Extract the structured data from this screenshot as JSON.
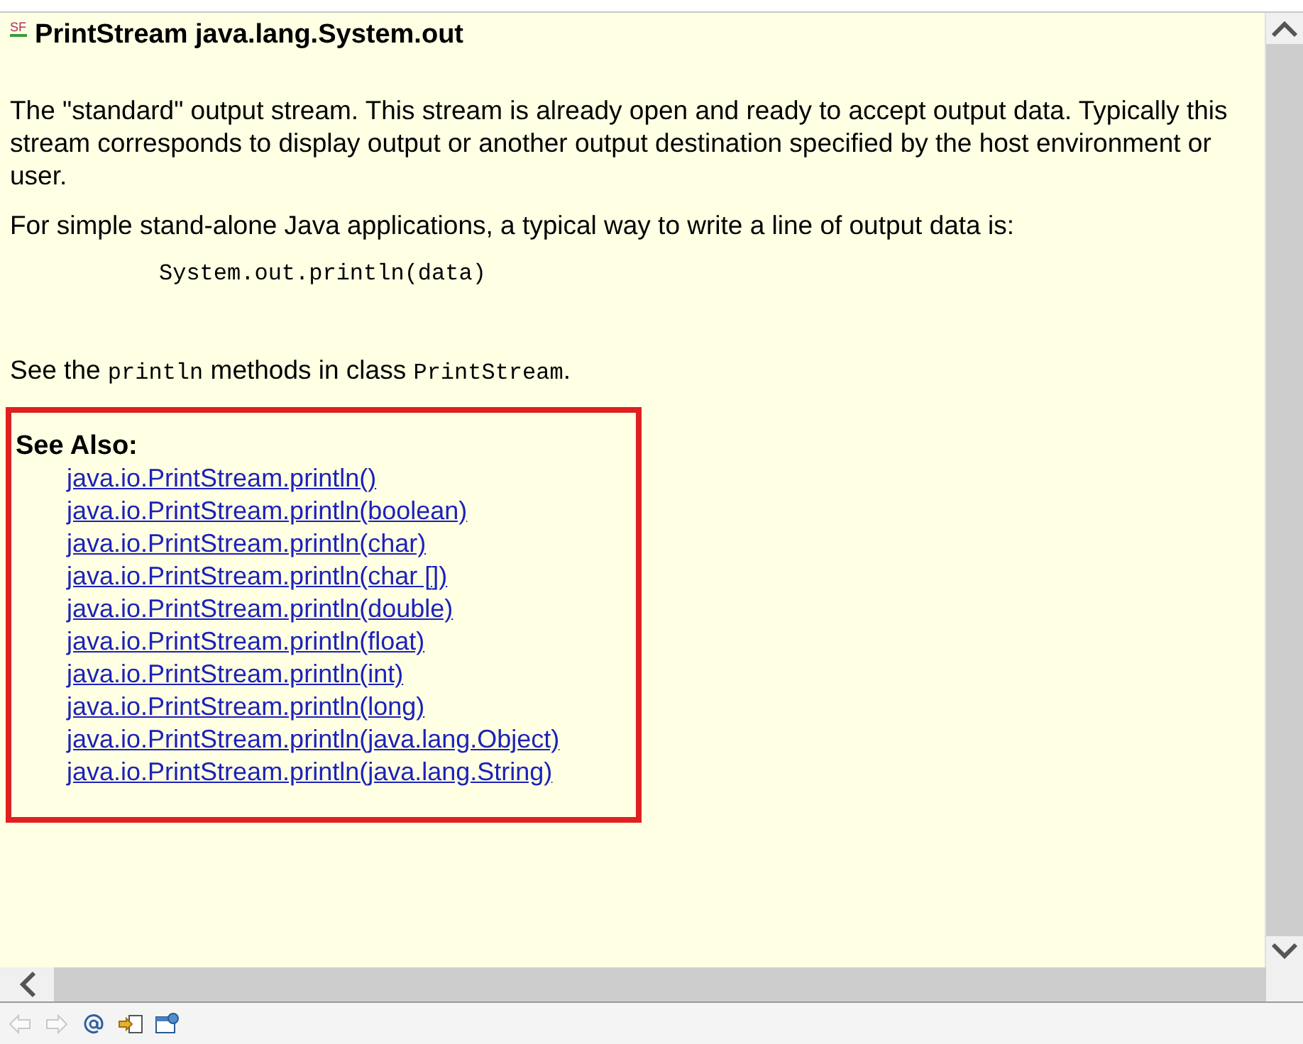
{
  "header": {
    "icon_label": "SF",
    "title": "PrintStream java.lang.System.out"
  },
  "description": "The \"standard\" output stream. This stream is already open and ready to accept output data. Typically this stream corresponds to display output or another output destination specified by the host environment or user.",
  "usage_intro": "For simple stand-alone Java applications, a typical way to write a line of output data is:",
  "code_sample": "System.out.println(data)",
  "see_the": [
    {
      "kind": "text",
      "text": "See the "
    },
    {
      "kind": "code",
      "text": "println"
    },
    {
      "kind": "text",
      "text": " methods in class "
    },
    {
      "kind": "code",
      "text": "PrintStream"
    },
    {
      "kind": "text",
      "text": "."
    }
  ],
  "see_also": {
    "heading": "See Also:",
    "highlighted": true,
    "links": [
      "java.io.PrintStream.println()",
      "java.io.PrintStream.println(boolean)",
      "java.io.PrintStream.println(char)",
      "java.io.PrintStream.println(char [])",
      "java.io.PrintStream.println(double)",
      "java.io.PrintStream.println(float)",
      "java.io.PrintStream.println(int)",
      "java.io.PrintStream.println(long)",
      "java.io.PrintStream.println(java.lang.Object)",
      "java.io.PrintStream.println(java.lang.String)"
    ]
  },
  "toolbar": [
    {
      "kind": "back",
      "disabled": true
    },
    {
      "kind": "forward",
      "disabled": true
    },
    {
      "kind": "at",
      "disabled": false
    },
    {
      "kind": "import",
      "disabled": false
    },
    {
      "kind": "window",
      "disabled": false
    }
  ]
}
